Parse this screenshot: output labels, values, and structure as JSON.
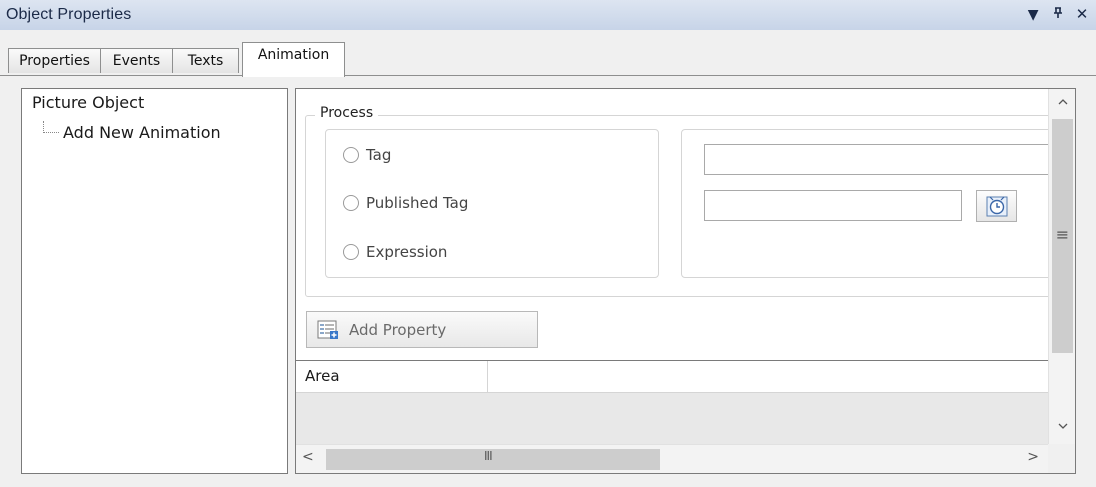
{
  "window": {
    "title": "Object Properties",
    "controls": {
      "dropdown": "▼",
      "pin": "ᵖ",
      "close": "✕"
    }
  },
  "tabs": [
    {
      "label": "Properties"
    },
    {
      "label": "Events"
    },
    {
      "label": "Texts"
    },
    {
      "label": "Animation",
      "active": true
    }
  ],
  "tree": {
    "root": "Picture Object",
    "child": "Add New Animation"
  },
  "process": {
    "legend": "Process",
    "options": [
      "Tag",
      "Published Tag",
      "Expression"
    ],
    "tag_value": "",
    "published_tag_value": ""
  },
  "add_property": {
    "label": "Add Property"
  },
  "grid": {
    "columns": [
      "Area"
    ]
  },
  "scroll": {
    "grip_h": "III",
    "grip_v": "≡",
    "left": "<",
    "right": ">",
    "up": "^",
    "down": "v"
  },
  "icons": {
    "clock": "clock-icon",
    "add_property": "add-property-icon"
  }
}
